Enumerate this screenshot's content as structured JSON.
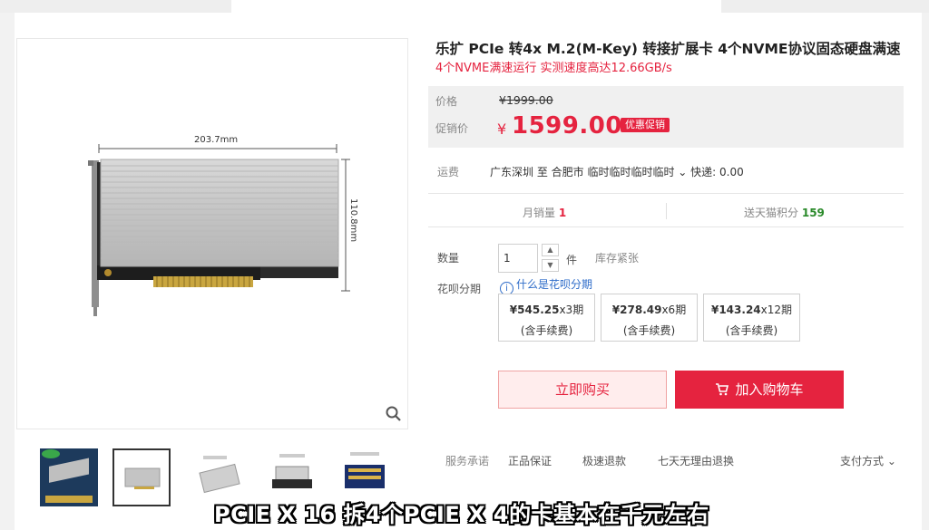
{
  "product": {
    "title": "乐扩 PCIe 转4x M.2(M-Key) 转接扩展卡 4个NVME协议固态硬盘满速",
    "subtitle": "4个NVME满速运行 实测速度高达12.66GB/s"
  },
  "image": {
    "dimension_width": "203.7mm",
    "dimension_height": "110.8mm",
    "zoom_icon": "magnifier-icon"
  },
  "price": {
    "list_label": "价格",
    "list_price": "¥1999.00",
    "promo_label": "促销价",
    "currency": "¥",
    "promo_price": "1599.00",
    "promo_badge": "优惠促销"
  },
  "shipping": {
    "label": "运费",
    "route": "广东深圳 至 合肥市 临时临时临时临时",
    "express": "快递: 0.00"
  },
  "stats": {
    "monthly_sales_label": "月销量",
    "monthly_sales": "1",
    "points_label": "送天猫积分",
    "points": "159"
  },
  "quantity": {
    "label": "数量",
    "value": "1",
    "unit": "件",
    "stock": "库存紧张"
  },
  "huabei": {
    "label": "花呗分期",
    "link": "什么是花呗分期",
    "plans": [
      {
        "amount": "¥545.25",
        "term": "x3期",
        "fee": "(含手续费)"
      },
      {
        "amount": "¥278.49",
        "term": "x6期",
        "fee": "(含手续费)"
      },
      {
        "amount": "¥143.24",
        "term": "x12期",
        "fee": "(含手续费)"
      }
    ]
  },
  "actions": {
    "buy_now": "立即购买",
    "add_to_cart": "加入购物车"
  },
  "service": {
    "label": "服务承诺",
    "items": [
      "正品保证",
      "极速退款",
      "七天无理由退换"
    ],
    "payment": "支付方式"
  },
  "caption": "PCIE X 16 拆4个PCIE X 4的卡基本在千元左右",
  "colors": {
    "accent": "#e5233f",
    "link": "#2e6cc9",
    "green": "#2a8a2a"
  }
}
